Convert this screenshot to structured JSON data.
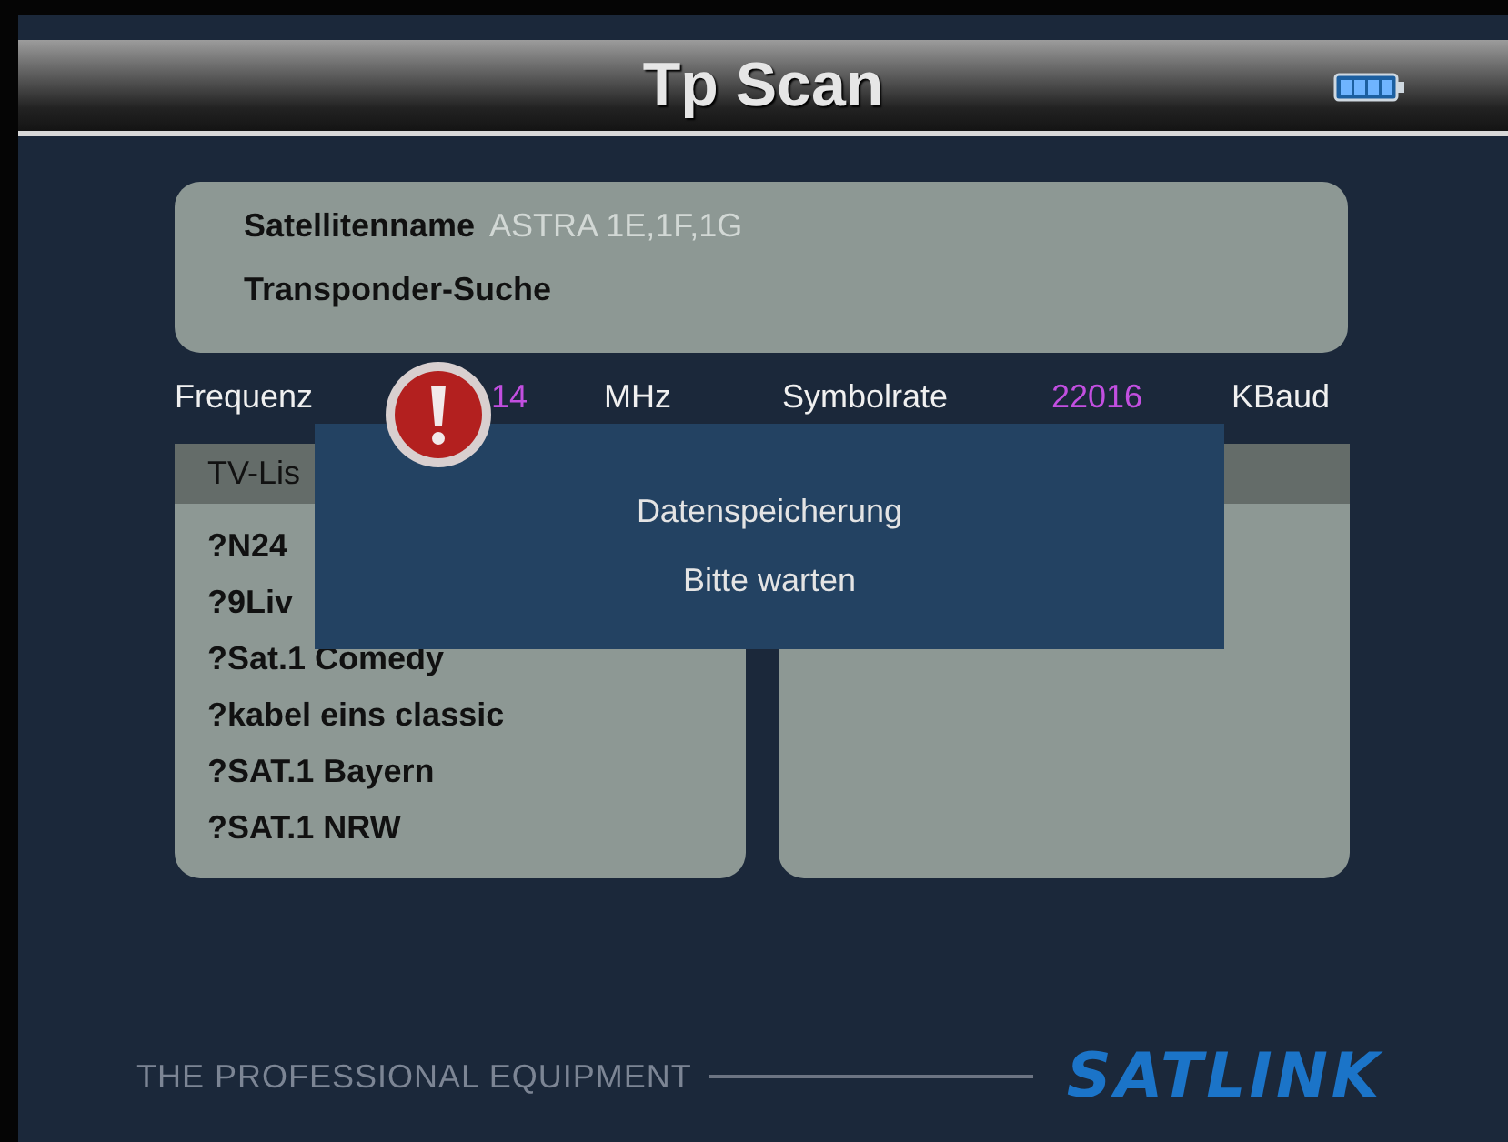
{
  "header": {
    "title": "Tp Scan"
  },
  "satellite": {
    "label": "Satellitenname",
    "value": "ASTRA 1E,1F,1G",
    "mode": "Transponder-Suche"
  },
  "params": [
    {
      "label": "Frequenz",
      "value": "14",
      "unit": "MHz"
    },
    {
      "label": "Symbolrate",
      "value": "22016",
      "unit": "KBaud"
    }
  ],
  "tv_list": {
    "title": "TV-Lis",
    "channels": [
      "?N24",
      "?9Liv",
      "?Sat.1 Comedy",
      "?kabel eins classic",
      "?SAT.1 Bayern",
      "?SAT.1 NRW"
    ]
  },
  "dialog": {
    "kind": "warning",
    "lines": [
      "Datenspeicherung",
      "Bitte warten"
    ]
  },
  "footer": {
    "slogan": "THE PROFESSIONAL EQUIPMENT",
    "logo": "SATLINK"
  }
}
